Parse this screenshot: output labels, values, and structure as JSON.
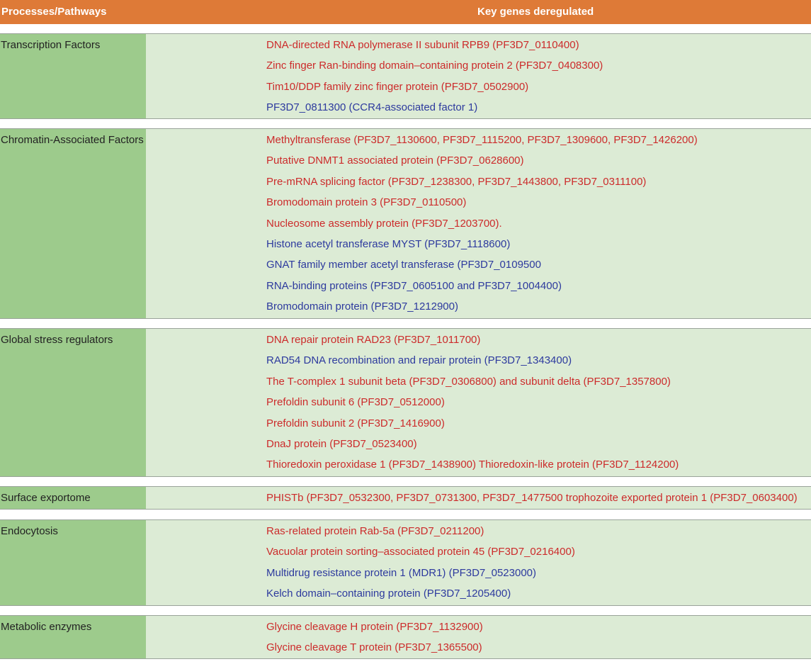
{
  "header": {
    "col1": "Processes/Pathways",
    "col2": "Key genes deregulated"
  },
  "colors": {
    "header_bg": "#de7a37",
    "left_bg": "#9dcb8c",
    "right_bg": "#dcebd5",
    "red_text": "#cc2b2b",
    "blue_text": "#2d3a9e"
  },
  "sections": [
    {
      "name": "Transcription Factors",
      "genes": [
        {
          "text": "DNA-directed RNA polymerase II subunit RPB9 (PF3D7_0110400)",
          "color": "red"
        },
        {
          "text": "Zinc finger Ran-binding domain–containing protein 2 (PF3D7_0408300)",
          "color": "red"
        },
        {
          "text": "Tim10/DDP family zinc finger protein (PF3D7_0502900)",
          "color": "red"
        },
        {
          "text": "PF3D7_0811300 (CCR4-associated factor 1)",
          "color": "blue"
        }
      ]
    },
    {
      "name": "Chromatin-Associated Factors",
      "genes": [
        {
          "text": "Methyltransferase (PF3D7_1130600, PF3D7_1115200, PF3D7_1309600, PF3D7_1426200)",
          "color": "red"
        },
        {
          "text": "Putative DNMT1 associated protein (PF3D7_0628600)",
          "color": "red"
        },
        {
          "text": "Pre-mRNA splicing factor (PF3D7_1238300, PF3D7_1443800, PF3D7_0311100)",
          "color": "red"
        },
        {
          "text": "Bromodomain protein 3 (PF3D7_0110500)",
          "color": "red"
        },
        {
          "text": "Nucleosome assembly protein (PF3D7_1203700).",
          "color": "red"
        },
        {
          "text": "Histone acetyl transferase MYST (PF3D7_1118600)",
          "color": "blue"
        },
        {
          "text": "GNAT family member acetyl transferase (PF3D7_0109500",
          "color": "blue"
        },
        {
          "text": "RNA-binding proteins (PF3D7_0605100 and PF3D7_1004400)",
          "color": "blue"
        },
        {
          "text": "Bromodomain protein (PF3D7_1212900)",
          "color": "blue"
        }
      ]
    },
    {
      "name": "Global stress regulators",
      "genes": [
        {
          "text": "DNA repair protein RAD23 (PF3D7_1011700)",
          "color": "red"
        },
        {
          "text": "RAD54 DNA recombination and repair protein (PF3D7_1343400)",
          "color": "blue"
        },
        {
          "text": "The T-complex 1 subunit beta (PF3D7_0306800) and subunit delta (PF3D7_1357800)",
          "color": "red"
        },
        {
          "text": "Prefoldin subunit 6 (PF3D7_0512000)",
          "color": "red"
        },
        {
          "text": "Prefoldin subunit 2 (PF3D7_1416900)",
          "color": "red"
        },
        {
          "text": "DnaJ protein (PF3D7_0523400)",
          "color": "red"
        },
        {
          "text": "Thioredoxin peroxidase 1 (PF3D7_1438900) Thioredoxin-like protein (PF3D7_1124200)",
          "color": "red"
        }
      ]
    },
    {
      "name": "Surface exportome",
      "genes": [
        {
          "text": "PHISTb (PF3D7_0532300, PF3D7_0731300, PF3D7_1477500 trophozoite exported protein 1 (PF3D7_0603400)",
          "color": "red"
        }
      ]
    },
    {
      "name": "Endocytosis",
      "genes": [
        {
          "text": "Ras-related protein Rab-5a (PF3D7_0211200)",
          "color": "red"
        },
        {
          "text": "Vacuolar protein sorting–associated protein 45 (PF3D7_0216400)",
          "color": "red"
        },
        {
          "text": "Multidrug resistance protein 1 (MDR1) (PF3D7_0523000)",
          "color": "blue"
        },
        {
          "text": "Kelch domain–containing protein (PF3D7_1205400)",
          "color": "blue"
        }
      ]
    },
    {
      "name": "Metabolic enzymes",
      "genes": [
        {
          "text": "Glycine cleavage H protein (PF3D7_1132900)",
          "color": "red"
        },
        {
          "text": "Glycine cleavage T protein (PF3D7_1365500)",
          "color": "red"
        }
      ]
    }
  ]
}
